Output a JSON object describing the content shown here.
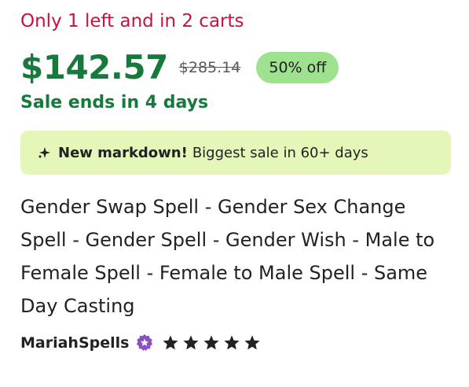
{
  "listing": {
    "stock_notice": "Only 1 left and in 2 carts",
    "price": "$142.57",
    "original_price": "$285.14",
    "discount_badge": "50% off",
    "sale_ends": "Sale ends in 4 days",
    "markdown": {
      "icon": "sparkle-icon",
      "bold": "New markdown!",
      "text": "Biggest sale in 60+ days"
    },
    "title": "Gender Swap Spell - Gender Sex Change Spell - Gender Spell - Gender Wish - Male to Female Spell - Female to Male Spell - Same Day Casting",
    "seller": {
      "name": "MariahSpells",
      "badge_icon": "star-seller-icon",
      "rating": 5,
      "rating_max": 5
    }
  },
  "colors": {
    "stock": "#c4133c",
    "price": "#157a3c",
    "badge_bg": "#9ee28f",
    "markdown_bg": "#e4f7b8",
    "star_seller": "#8b4fc6"
  }
}
